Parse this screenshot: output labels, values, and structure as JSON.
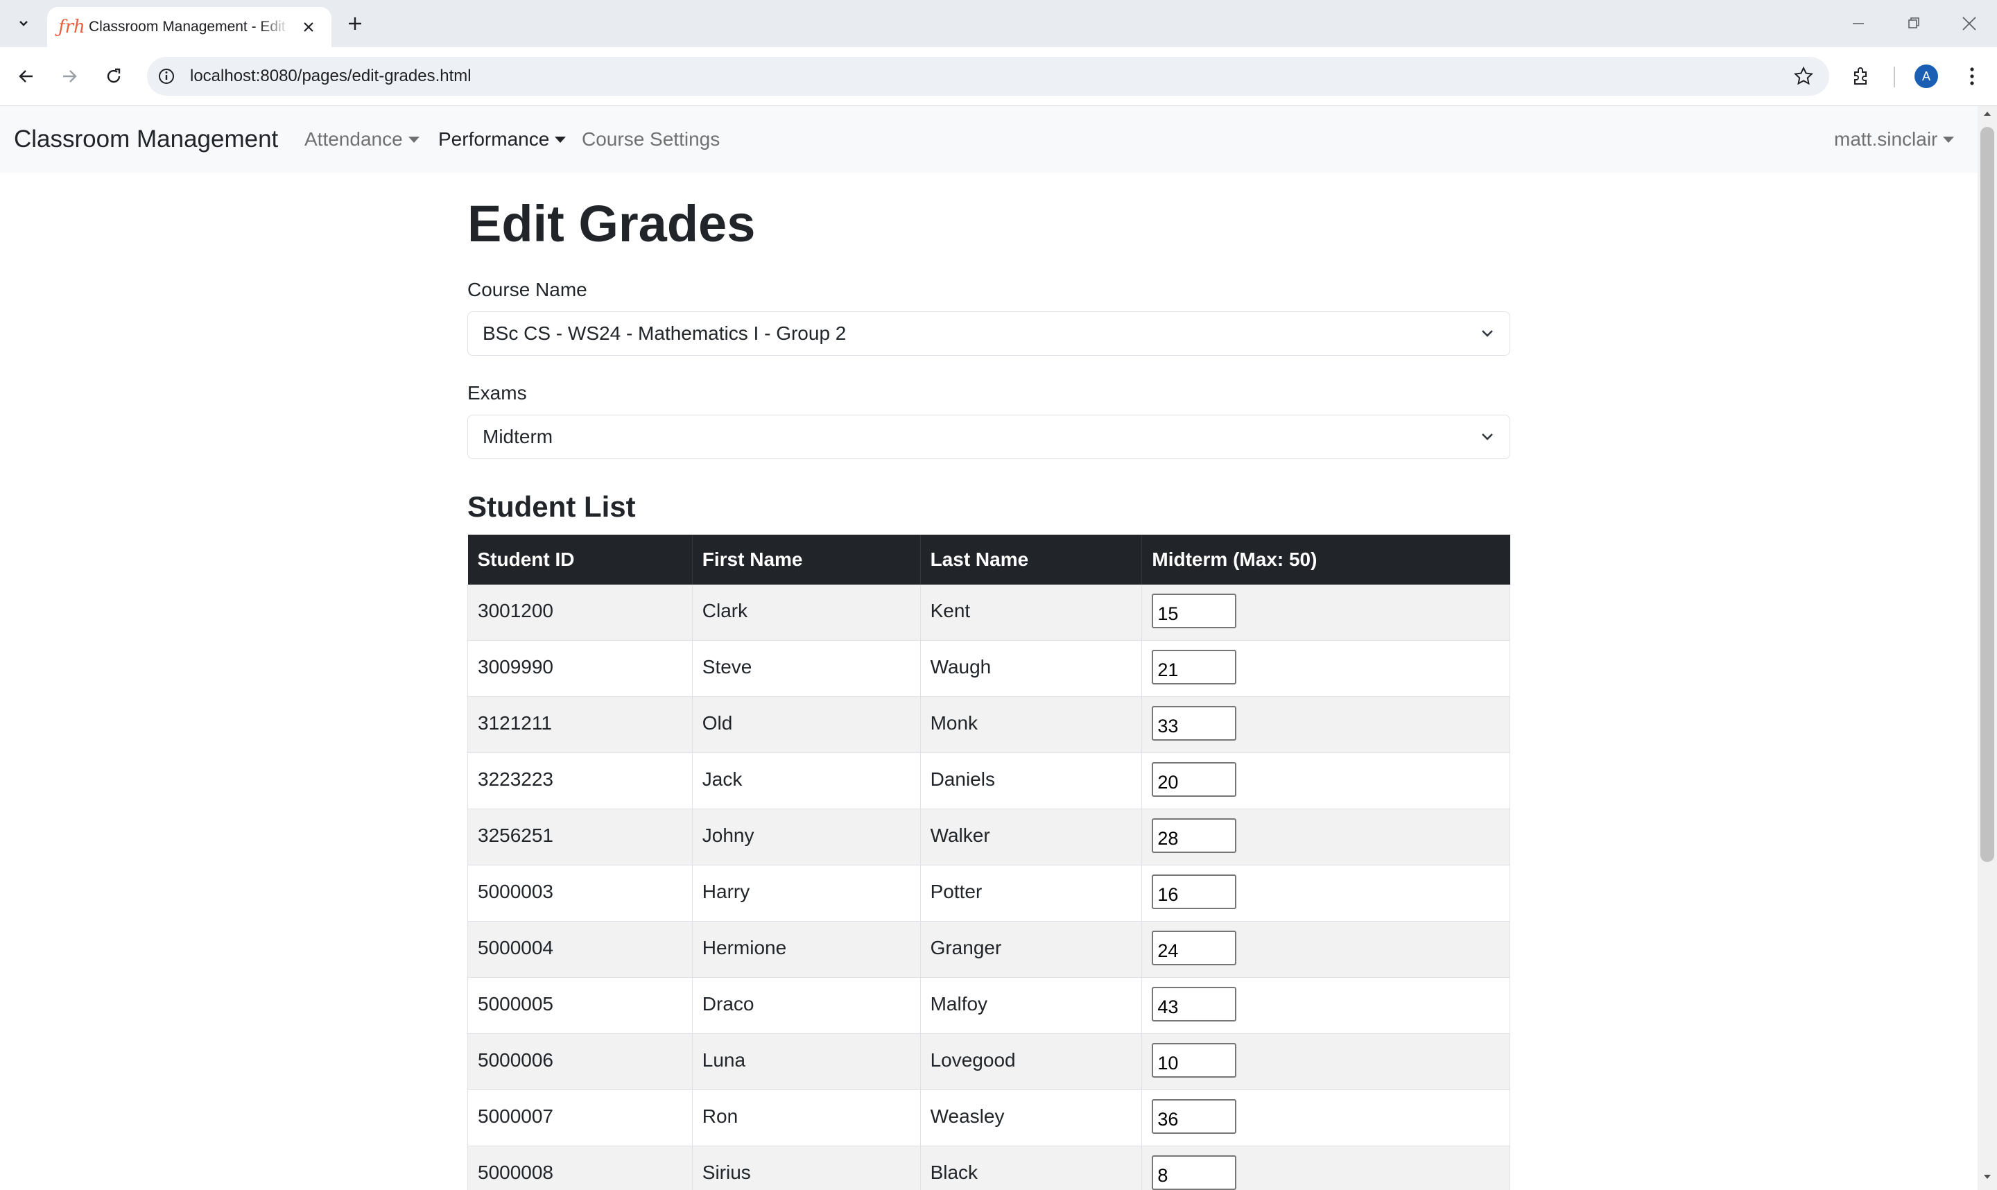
{
  "browser": {
    "tab_title": "Classroom Management - Edit Grades",
    "favicon_text": "ƒrh",
    "url": "localhost:8080/pages/edit-grades.html",
    "profile_initial": "A"
  },
  "navbar": {
    "brand": "Classroom Management",
    "links": [
      {
        "label": "Attendance",
        "dropdown": true,
        "active": false
      },
      {
        "label": "Performance",
        "dropdown": true,
        "active": true
      },
      {
        "label": "Course Settings",
        "dropdown": false,
        "active": false
      }
    ],
    "user": "matt.sinclair"
  },
  "page": {
    "title": "Edit Grades",
    "course_label": "Course Name",
    "course_value": "BSc CS - WS24 - Mathematics I - Group 2",
    "exam_label": "Exams",
    "exam_value": "Midterm",
    "list_title": "Student List"
  },
  "table": {
    "headers": [
      "Student ID",
      "First Name",
      "Last Name",
      "Midterm (Max: 50)"
    ],
    "rows": [
      {
        "id": "3001200",
        "first": "Clark",
        "last": "Kent",
        "grade": "15"
      },
      {
        "id": "3009990",
        "first": "Steve",
        "last": "Waugh",
        "grade": "21"
      },
      {
        "id": "3121211",
        "first": "Old",
        "last": "Monk",
        "grade": "33"
      },
      {
        "id": "3223223",
        "first": "Jack",
        "last": "Daniels",
        "grade": "20"
      },
      {
        "id": "3256251",
        "first": "Johny",
        "last": "Walker",
        "grade": "28"
      },
      {
        "id": "5000003",
        "first": "Harry",
        "last": "Potter",
        "grade": "16"
      },
      {
        "id": "5000004",
        "first": "Hermione",
        "last": "Granger",
        "grade": "24"
      },
      {
        "id": "5000005",
        "first": "Draco",
        "last": "Malfoy",
        "grade": "43"
      },
      {
        "id": "5000006",
        "first": "Luna",
        "last": "Lovegood",
        "grade": "10"
      },
      {
        "id": "5000007",
        "first": "Ron",
        "last": "Weasley",
        "grade": "36"
      },
      {
        "id": "5000008",
        "first": "Sirius",
        "last": "Black",
        "grade": "8"
      }
    ]
  },
  "colors": {
    "table_header_bg": "#212529",
    "navbar_bg": "#f8f9fa",
    "striped_row_bg": "#f2f2f2",
    "favicon": "#e8603c",
    "avatar": "#1a5fb4"
  }
}
